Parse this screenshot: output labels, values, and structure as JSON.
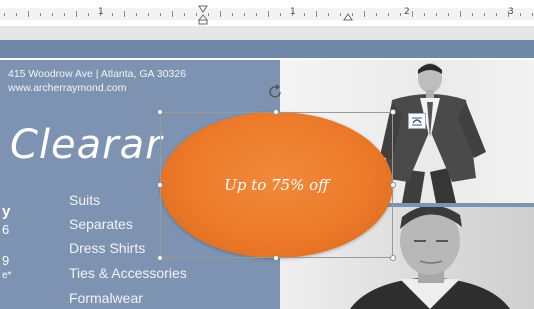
{
  "ruler": {
    "numbers": [
      "1",
      "1",
      "2",
      "3"
    ]
  },
  "document": {
    "address_line1": "415 Woodrow Ave | Atlanta, GA 30326",
    "address_line2": "www.archerraymond.com",
    "headline": "Clearar",
    "categories": [
      "Suits",
      "Separates",
      "Dress Shirts",
      "Ties & Accessories",
      "Formalwear"
    ],
    "cut_off_chars": [
      "y",
      "6",
      "9",
      "e*"
    ]
  },
  "shape": {
    "text": "Up to 75% off",
    "fill_color": "#ec7a2a",
    "selected": true
  },
  "icons": {
    "rotate": "rotate-handle-icon",
    "layout": "layout-options-icon"
  },
  "colors": {
    "panel": "#7e93b1",
    "header": "#6f87a8"
  }
}
